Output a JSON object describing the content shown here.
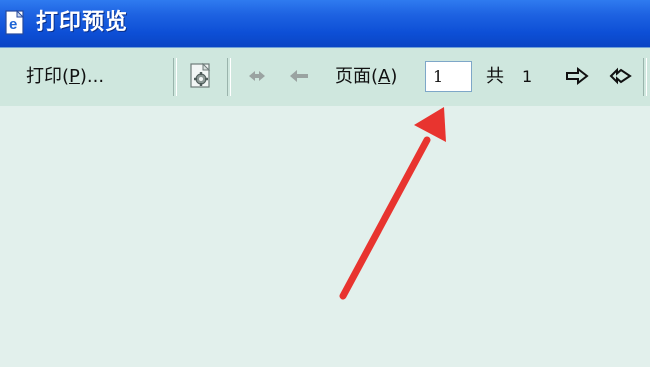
{
  "window": {
    "title": "打印预览",
    "icon": "document-app-icon",
    "colors": {
      "titlebar": "#0d4fd6",
      "toolbar": "#cfe7de",
      "workspace": "#e2f0ec",
      "annotation_arrow": "#e8342f"
    }
  },
  "toolbar": {
    "print_label_prefix": "打印(",
    "print_label_key": "P",
    "print_label_suffix": ")...",
    "page_setup_icon": "page-setup-icon",
    "first_page_icon": "double-left-arrow-icon",
    "prev_page_icon": "left-arrow-icon",
    "page_label_prefix": "页面(",
    "page_label_key": "A",
    "page_label_suffix": ")",
    "page_value": "1",
    "total_label": "共",
    "total_value": "1",
    "next_page_icon": "right-arrow-icon",
    "last_page_icon": "double-right-arrow-icon"
  },
  "annotation": {
    "type": "red-arrow",
    "points_to": "page-number-input"
  }
}
